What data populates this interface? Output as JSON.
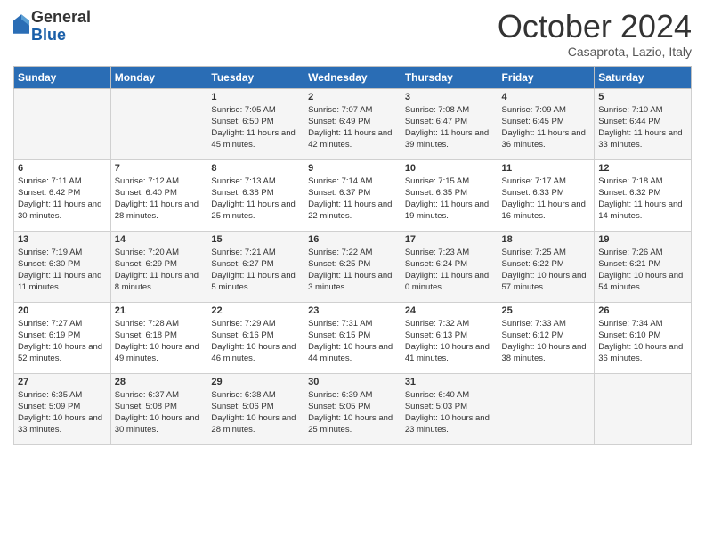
{
  "header": {
    "logo_general": "General",
    "logo_blue": "Blue",
    "month": "October 2024",
    "location": "Casaprota, Lazio, Italy"
  },
  "days_of_week": [
    "Sunday",
    "Monday",
    "Tuesday",
    "Wednesday",
    "Thursday",
    "Friday",
    "Saturday"
  ],
  "weeks": [
    [
      {
        "day": "",
        "sunrise": "",
        "sunset": "",
        "daylight": ""
      },
      {
        "day": "",
        "sunrise": "",
        "sunset": "",
        "daylight": ""
      },
      {
        "day": "1",
        "sunrise": "Sunrise: 7:05 AM",
        "sunset": "Sunset: 6:50 PM",
        "daylight": "Daylight: 11 hours and 45 minutes."
      },
      {
        "day": "2",
        "sunrise": "Sunrise: 7:07 AM",
        "sunset": "Sunset: 6:49 PM",
        "daylight": "Daylight: 11 hours and 42 minutes."
      },
      {
        "day": "3",
        "sunrise": "Sunrise: 7:08 AM",
        "sunset": "Sunset: 6:47 PM",
        "daylight": "Daylight: 11 hours and 39 minutes."
      },
      {
        "day": "4",
        "sunrise": "Sunrise: 7:09 AM",
        "sunset": "Sunset: 6:45 PM",
        "daylight": "Daylight: 11 hours and 36 minutes."
      },
      {
        "day": "5",
        "sunrise": "Sunrise: 7:10 AM",
        "sunset": "Sunset: 6:44 PM",
        "daylight": "Daylight: 11 hours and 33 minutes."
      }
    ],
    [
      {
        "day": "6",
        "sunrise": "Sunrise: 7:11 AM",
        "sunset": "Sunset: 6:42 PM",
        "daylight": "Daylight: 11 hours and 30 minutes."
      },
      {
        "day": "7",
        "sunrise": "Sunrise: 7:12 AM",
        "sunset": "Sunset: 6:40 PM",
        "daylight": "Daylight: 11 hours and 28 minutes."
      },
      {
        "day": "8",
        "sunrise": "Sunrise: 7:13 AM",
        "sunset": "Sunset: 6:38 PM",
        "daylight": "Daylight: 11 hours and 25 minutes."
      },
      {
        "day": "9",
        "sunrise": "Sunrise: 7:14 AM",
        "sunset": "Sunset: 6:37 PM",
        "daylight": "Daylight: 11 hours and 22 minutes."
      },
      {
        "day": "10",
        "sunrise": "Sunrise: 7:15 AM",
        "sunset": "Sunset: 6:35 PM",
        "daylight": "Daylight: 11 hours and 19 minutes."
      },
      {
        "day": "11",
        "sunrise": "Sunrise: 7:17 AM",
        "sunset": "Sunset: 6:33 PM",
        "daylight": "Daylight: 11 hours and 16 minutes."
      },
      {
        "day": "12",
        "sunrise": "Sunrise: 7:18 AM",
        "sunset": "Sunset: 6:32 PM",
        "daylight": "Daylight: 11 hours and 14 minutes."
      }
    ],
    [
      {
        "day": "13",
        "sunrise": "Sunrise: 7:19 AM",
        "sunset": "Sunset: 6:30 PM",
        "daylight": "Daylight: 11 hours and 11 minutes."
      },
      {
        "day": "14",
        "sunrise": "Sunrise: 7:20 AM",
        "sunset": "Sunset: 6:29 PM",
        "daylight": "Daylight: 11 hours and 8 minutes."
      },
      {
        "day": "15",
        "sunrise": "Sunrise: 7:21 AM",
        "sunset": "Sunset: 6:27 PM",
        "daylight": "Daylight: 11 hours and 5 minutes."
      },
      {
        "day": "16",
        "sunrise": "Sunrise: 7:22 AM",
        "sunset": "Sunset: 6:25 PM",
        "daylight": "Daylight: 11 hours and 3 minutes."
      },
      {
        "day": "17",
        "sunrise": "Sunrise: 7:23 AM",
        "sunset": "Sunset: 6:24 PM",
        "daylight": "Daylight: 11 hours and 0 minutes."
      },
      {
        "day": "18",
        "sunrise": "Sunrise: 7:25 AM",
        "sunset": "Sunset: 6:22 PM",
        "daylight": "Daylight: 10 hours and 57 minutes."
      },
      {
        "day": "19",
        "sunrise": "Sunrise: 7:26 AM",
        "sunset": "Sunset: 6:21 PM",
        "daylight": "Daylight: 10 hours and 54 minutes."
      }
    ],
    [
      {
        "day": "20",
        "sunrise": "Sunrise: 7:27 AM",
        "sunset": "Sunset: 6:19 PM",
        "daylight": "Daylight: 10 hours and 52 minutes."
      },
      {
        "day": "21",
        "sunrise": "Sunrise: 7:28 AM",
        "sunset": "Sunset: 6:18 PM",
        "daylight": "Daylight: 10 hours and 49 minutes."
      },
      {
        "day": "22",
        "sunrise": "Sunrise: 7:29 AM",
        "sunset": "Sunset: 6:16 PM",
        "daylight": "Daylight: 10 hours and 46 minutes."
      },
      {
        "day": "23",
        "sunrise": "Sunrise: 7:31 AM",
        "sunset": "Sunset: 6:15 PM",
        "daylight": "Daylight: 10 hours and 44 minutes."
      },
      {
        "day": "24",
        "sunrise": "Sunrise: 7:32 AM",
        "sunset": "Sunset: 6:13 PM",
        "daylight": "Daylight: 10 hours and 41 minutes."
      },
      {
        "day": "25",
        "sunrise": "Sunrise: 7:33 AM",
        "sunset": "Sunset: 6:12 PM",
        "daylight": "Daylight: 10 hours and 38 minutes."
      },
      {
        "day": "26",
        "sunrise": "Sunrise: 7:34 AM",
        "sunset": "Sunset: 6:10 PM",
        "daylight": "Daylight: 10 hours and 36 minutes."
      }
    ],
    [
      {
        "day": "27",
        "sunrise": "Sunrise: 6:35 AM",
        "sunset": "Sunset: 5:09 PM",
        "daylight": "Daylight: 10 hours and 33 minutes."
      },
      {
        "day": "28",
        "sunrise": "Sunrise: 6:37 AM",
        "sunset": "Sunset: 5:08 PM",
        "daylight": "Daylight: 10 hours and 30 minutes."
      },
      {
        "day": "29",
        "sunrise": "Sunrise: 6:38 AM",
        "sunset": "Sunset: 5:06 PM",
        "daylight": "Daylight: 10 hours and 28 minutes."
      },
      {
        "day": "30",
        "sunrise": "Sunrise: 6:39 AM",
        "sunset": "Sunset: 5:05 PM",
        "daylight": "Daylight: 10 hours and 25 minutes."
      },
      {
        "day": "31",
        "sunrise": "Sunrise: 6:40 AM",
        "sunset": "Sunset: 5:03 PM",
        "daylight": "Daylight: 10 hours and 23 minutes."
      },
      {
        "day": "",
        "sunrise": "",
        "sunset": "",
        "daylight": ""
      },
      {
        "day": "",
        "sunrise": "",
        "sunset": "",
        "daylight": ""
      }
    ]
  ]
}
